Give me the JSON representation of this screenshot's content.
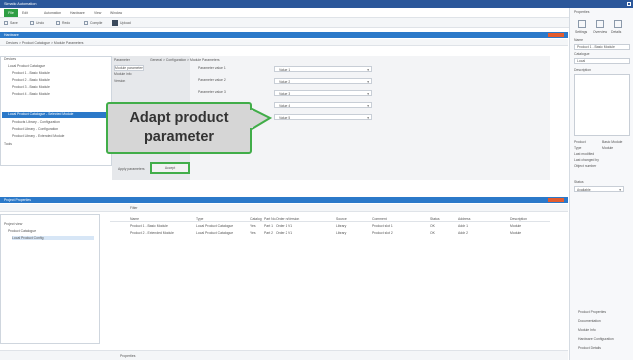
{
  "window": {
    "title": "Simatic Automation"
  },
  "menubar": {
    "file_label": "File",
    "items": [
      "Edit",
      "Automation",
      "Hardware",
      "View",
      "Window"
    ]
  },
  "toolbar": {
    "items": [
      "Save",
      "Undo",
      "Redo",
      "Compile",
      "Upload"
    ]
  },
  "top_panel": {
    "title": "Hardware",
    "breadcrumb": "Devices > Product Catalogue > Module Parameters",
    "tree_items": [
      "Devices",
      "Local Product Catalogue",
      "Product 1 - Basic Module",
      "Product 2 - Basic Module",
      "Product 3 - Basic Module",
      "Product 4 - Basic Module",
      "Local Product Catalogue - Selected Module",
      "Products Library - Configuration",
      "Product Library - Configuration",
      "Product Library - Extended Module",
      "Tools"
    ],
    "selected_index": 6,
    "middle_header": "Parameter",
    "middle_items": [
      "Module parameters",
      "Module info",
      "Version"
    ],
    "details_header": "General > Configuration > Module Parameters",
    "param_rows": [
      {
        "label": "Parameter value 1",
        "value": "Value 1"
      },
      {
        "label": "Parameter value 2",
        "value": "Value 2"
      },
      {
        "label": "Parameter value 3",
        "value": "Value 3"
      },
      {
        "label": "Parameter value 4",
        "value": "Value 4"
      },
      {
        "label": "Parameter value 5",
        "value": "Value 5"
      }
    ],
    "footer_label": "Apply parameters",
    "footer_button": "Accept"
  },
  "callout": {
    "line1": "Adapt product",
    "line2": "parameter"
  },
  "bottom_panel": {
    "title": "Project Properties",
    "filter_label": "Filter",
    "tree_items": [
      "Project view",
      "Product Catalogue",
      "Local Product Config"
    ],
    "columns": [
      "Name",
      "Type",
      "Catalog",
      "Part No.",
      "Order no.",
      "Version",
      "Source",
      "Comment",
      "Status",
      "Address",
      "Description"
    ],
    "rows": [
      [
        "Product 1 - Basic Module",
        "Local Product Catalogue",
        "Yes",
        "Part 1",
        "Order 1",
        "V1",
        "Library",
        "Product slot 1",
        "OK",
        "Addr 1",
        "Module"
      ],
      [
        "Product 2 - Extended Module",
        "Local Product Catalogue",
        "Yes",
        "Part 2",
        "Order 2",
        "V1",
        "Library",
        "Product slot 2",
        "OK",
        "Addr 2",
        "Module"
      ]
    ],
    "status_tab": "Properties"
  },
  "right_panel": {
    "title": "Properties",
    "tabs": [
      "Settings",
      "Overview",
      "Details"
    ],
    "fields": [
      {
        "label": "Name",
        "value": "Product 1 - Basic Module"
      },
      {
        "label": "Catalogue",
        "value": "Local"
      },
      {
        "label": "Description",
        "value": ""
      }
    ],
    "info_rows": [
      "Product",
      "Type",
      "Last modified",
      "Last changed by",
      "Object number"
    ],
    "info_values": [
      "Basic Module",
      "Module",
      "",
      "",
      ""
    ],
    "select_label": "Status",
    "select_value": "Available",
    "bottom_links": [
      "Product Properties",
      "Documentation",
      "Module Info",
      "Hardware Configuration",
      "Product Details"
    ]
  },
  "statusbar": {
    "text": "Properties"
  },
  "colors": {
    "accent_blue": "#2b79c9",
    "callout_green": "#41ad49",
    "callout_fill": "#d6d6d6",
    "file_green": "#2f9e44"
  }
}
